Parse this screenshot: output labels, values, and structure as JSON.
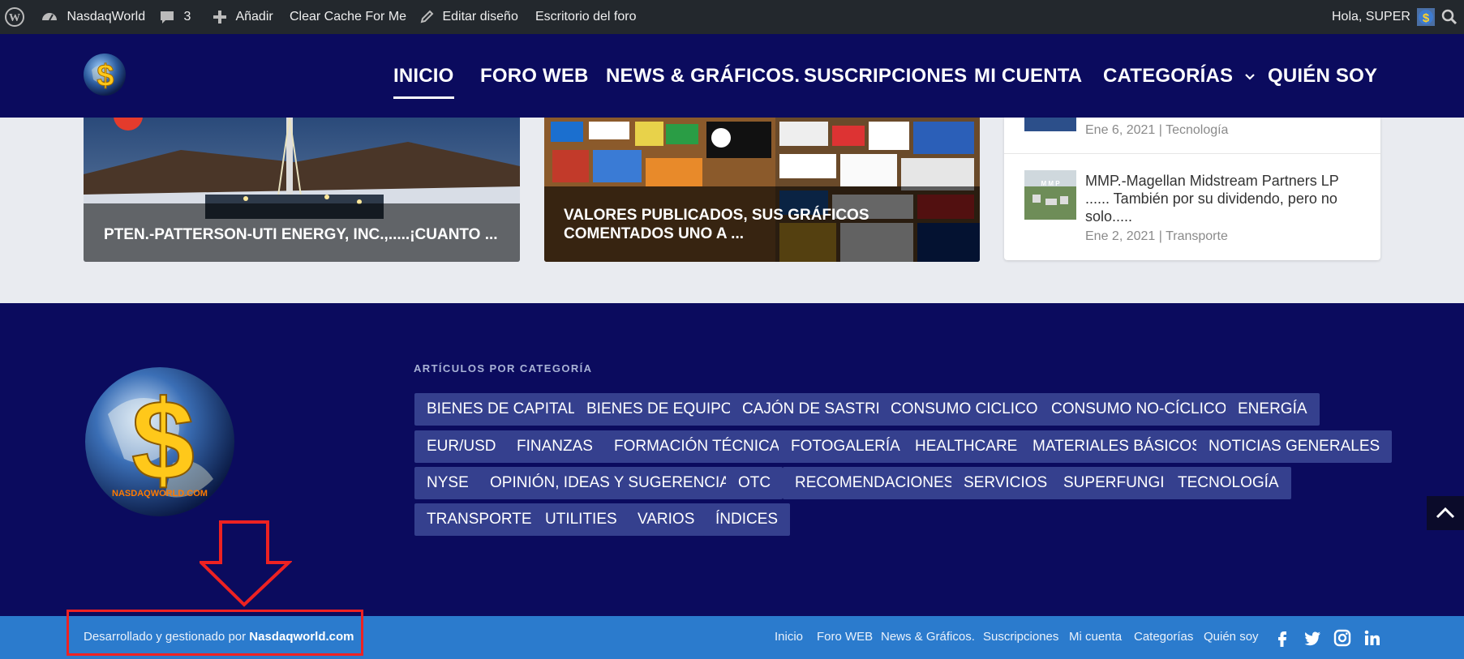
{
  "admin_bar": {
    "site_name": "NasdaqWorld",
    "comments_count": "3",
    "add_label": "Añadir",
    "clear_cache_label": "Clear Cache For Me",
    "edit_design_label": "Editar diseño",
    "forum_desk_label": "Escritorio del foro",
    "greeting": "Hola, SUPER"
  },
  "nav": {
    "items": [
      {
        "label": "INICIO"
      },
      {
        "label": "FORO WEB"
      },
      {
        "label": "NEWS & GRÁFICOS."
      },
      {
        "label": "SUSCRIPCIONES"
      },
      {
        "label": "MI CUENTA"
      },
      {
        "label": "CATEGORÍAS"
      },
      {
        "label": "QUIÉN SOY"
      }
    ],
    "active_index": 0
  },
  "featured": [
    {
      "title": "PTEN.-PATTERSON-UTI ENERGY, INC.,.....¡CUANTO ..."
    },
    {
      "title": "VALORES PUBLICADOS, SUS GRÁFICOS COMENTADOS UNO A ..."
    }
  ],
  "sidebar_posts": [
    {
      "title": "",
      "date": "Ene 6, 2021",
      "category": "Tecnología"
    },
    {
      "title": "MMP.-Magellan Midstream Partners LP ...... También por su dividendo, pero no solo.....",
      "date": "Ene 2, 2021",
      "category": "Transporte"
    }
  ],
  "footer": {
    "logo_text": "NASDAQWORLD.COM",
    "tags_title": "ARTÍCULOS POR CATEGORÍA",
    "tags": [
      "BIENES DE CAPITAL",
      "BIENES DE EQUIPO",
      "CAJÓN DE SASTRE",
      "CONSUMO CICLICO",
      "CONSUMO NO-CÍCLICO",
      "ENERGÍA",
      "EUR/USD",
      "FINANZAS",
      "FORMACIÓN TÉCNICA",
      "FOTOGALERÍA",
      "HEALTHCARE",
      "MATERIALES BÁSICOS",
      "NOTICIAS GENERALES",
      "NYSE",
      "OPINIÓN, IDEAS Y SUGERENCIAS",
      "OTC",
      "RECOMENDACIONES",
      "SERVICIOS",
      "SUPERFUNGI",
      "TECNOLOGÍA",
      "TRANSPORTE",
      "UTILITIES",
      "VARIOS",
      "ÍNDICES"
    ]
  },
  "bottom_bar": {
    "credit_prefix": "Desarrollado y gestionado por",
    "credit_link": "Nasdaqworld.com",
    "links": [
      "Inicio",
      "Foro WEB",
      "News & Gráficos.",
      "Suscripciones",
      "Mi cuenta",
      "Categorías",
      "Quién soy"
    ]
  },
  "colors": {
    "nav_bg": "#0b0b5e",
    "content_bg": "#e9ebf0",
    "tag_bg": "#35408e",
    "bottom_bar_bg": "#2b7bcd",
    "highlight": "#e22222"
  },
  "icons": [
    "wordpress-icon",
    "dashboard-icon",
    "comment-icon",
    "plus-icon",
    "pencil-icon",
    "avatar-icon",
    "search-icon",
    "chevron-down-icon",
    "facebook-icon",
    "twitter-icon",
    "instagram-icon",
    "linkedin-icon",
    "arrow-up-icon",
    "down-arrow-annotation"
  ]
}
